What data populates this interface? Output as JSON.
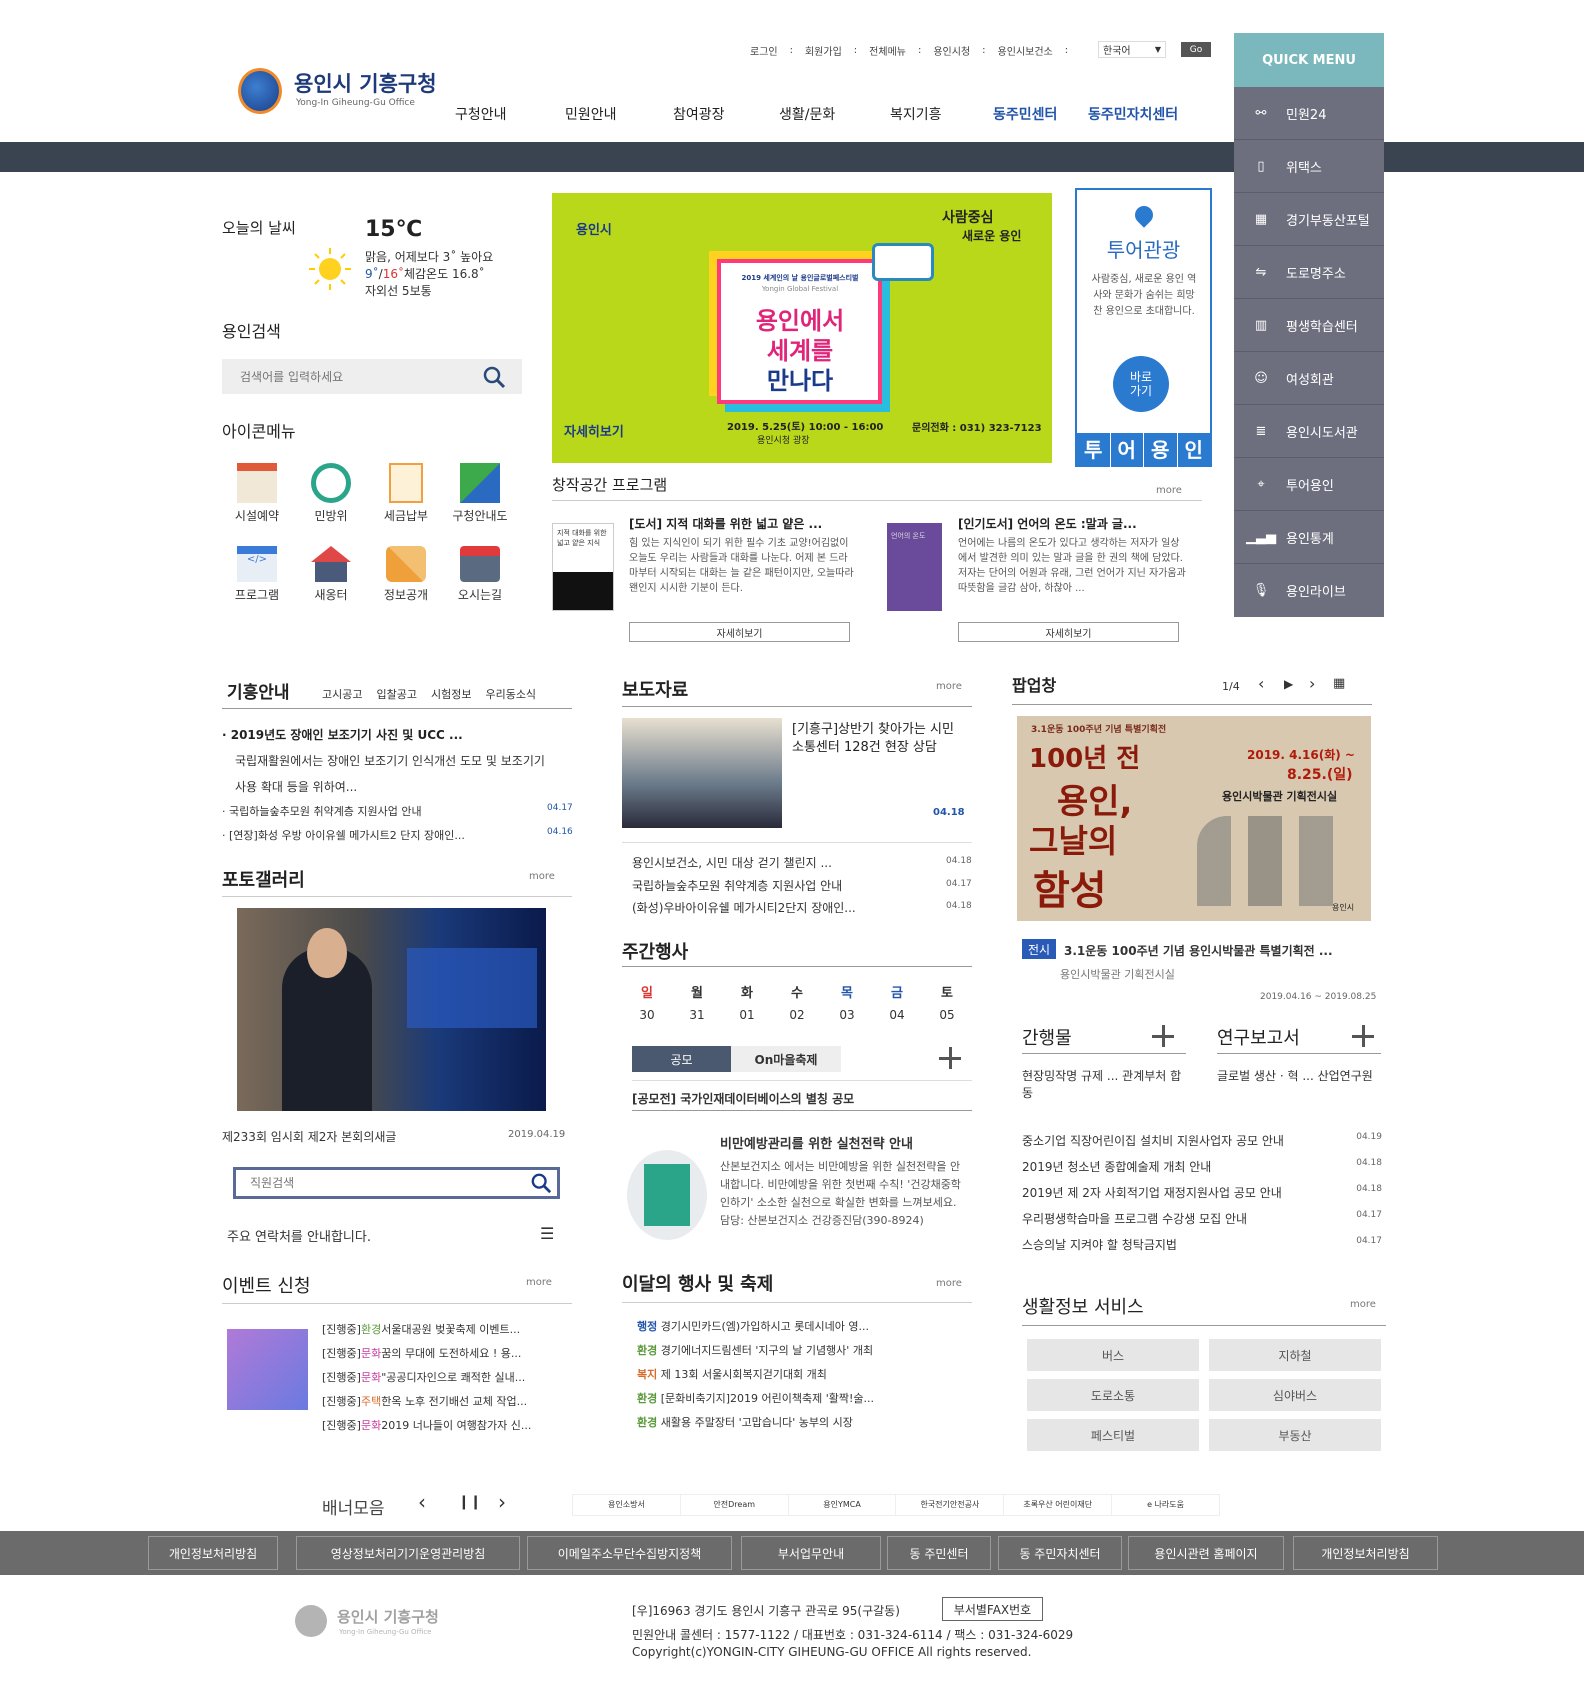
{
  "header": {
    "logo": {
      "name": "용인시 기흥구청",
      "sub": "Yong-In Giheung-Gu Office"
    },
    "util": [
      "로그인",
      "회원가입",
      "전체메뉴",
      "용인시청",
      "용인시보건소"
    ],
    "lang": "한국어",
    "go": "Go",
    "gnb": [
      "구청안내",
      "민원안내",
      "참여광장",
      "생활/문화",
      "복지기흥",
      "동주민센터",
      "동주민자치센터"
    ]
  },
  "quick_menu": {
    "title": "QUICK MENU",
    "items": [
      "민원24",
      "위택스",
      "경기부동산포털",
      "도로명주소",
      "평생학습센터",
      "여성회관",
      "용인시도서관",
      "투어용인",
      "용인통계",
      "용인라이브"
    ]
  },
  "weather": {
    "title": "오늘의 날씨",
    "temp": "15℃",
    "desc": "맑음, 어제보다 3˚ 높아요",
    "minmax_low": "9˚",
    "minmax_sep": "/",
    "minmax_high": "16˚",
    "feel": "체감온도 16.8˚",
    "uv": "자외선 5보통"
  },
  "search": {
    "title": "용인검색",
    "placeholder": "검색어를 입력하세요"
  },
  "icon_menu": {
    "title": "아이콘메뉴",
    "items": [
      "시설예약",
      "민방위",
      "세금납부",
      "구청안내도",
      "프로그램",
      "새옹터",
      "정보공개",
      "오시는길"
    ]
  },
  "banner": {
    "logo": "용인시",
    "slogan1": "사람중심",
    "slogan2": "새로운 용인",
    "festival_sub": "2019 세계인의 날 용인글로벌페스티벌",
    "festival_en": "Yongin Global Festival",
    "main1": "용인에서",
    "main2": "세계를",
    "main3": "만나다",
    "date": "2019. 5.25(토) 10:00 - 16:00",
    "place": "용인시청 광장",
    "contact": "문의전화 : 031) 323-7123",
    "detail": "자세히보기"
  },
  "tour": {
    "title": "투어관광",
    "desc": "사람중심, 새로운 용인 역사와 문화가 숨쉬는 희망찬 용인으로 초대합니다.",
    "go": "바로\n가기",
    "chars": [
      "투",
      "어",
      "용",
      "인"
    ]
  },
  "creative": {
    "title": "창작공간 프로그램",
    "more": "more",
    "books": [
      {
        "title": "[도서] 지적 대화를 위한 넓고 얕은 ...",
        "desc": "힘 있는 지식인이 되기 위한 필수 기초 교양!어김없이 오늘도 우리는 사람들과 대화를 나눈다. 어제 본 드라마부터 시작되는 대화는 늘 같은 패턴이지만, 오늘따라 왠인지 시시한 기분이 든다.",
        "btn": "자세히보기",
        "cover": "지적 대화를 위한 넓고 얕은 지식"
      },
      {
        "title": "[인기도서] 언어의 온도 :말과 글...",
        "desc": "언어에는 나름의 온도가 있다고 생각하는 저자가 일상에서 발견한 의미 있는 말과 글을 한 권의 책에 담았다. 저자는 단어의 어원과 유래, 그런 언어가 지닌 자가움과 따뜻함을 글감 삼아, 하찮아 ...",
        "btn": "자세히보기",
        "cover": "언어의 온도"
      }
    ]
  },
  "giheung": {
    "title": "기흥안내",
    "tabs": [
      "고시공고",
      "입찰공고",
      "시험정보",
      "우리동소식"
    ],
    "featured_title": "· 2019년도 장애인 보조기기 사진 및 UCC ...",
    "featured_desc": "국립재활원에서는 장애인 보조기기 인식개선 도모 및 보조기기 사용 확대 등을 위하여...",
    "items": [
      {
        "t": "· 국립하늘숲추모원 취약계층 지원사업 안내",
        "d": "04.17"
      },
      {
        "t": "· [연장]화성 우방 아이유쉘 메가시트2 단지 장애인...",
        "d": "04.16"
      }
    ]
  },
  "press": {
    "title": "보도자료",
    "more": "more",
    "featured": "[기흥구]상반기 찾아가는 시민소통센터 128건 현장 상담",
    "featured_date": "04.18",
    "items": [
      {
        "t": "용인시보건소, 시민 대상 걷기 챌린지 ...",
        "d": "04.18"
      },
      {
        "t": "국립하늘숲추모원 취약계층 지원사업 안내",
        "d": "04.17"
      },
      {
        "t": "(화성)우바아이유쉘 메가시티2단지 장애인...",
        "d": "04.18"
      }
    ]
  },
  "popup": {
    "title": "팝업창",
    "page": "1/4",
    "img_l1": "3.1운동 100주년 기념 특별기획전",
    "img_big1": "100년 전",
    "img_big2": "용인,",
    "img_big3": "그날의",
    "img_big4": "함성",
    "img_date1": "2019. 4.16(화) ~",
    "img_date2": "8.25.(일)",
    "img_place": "용인시박물관 기획전시실",
    "img_logo": "용인시",
    "badge": "전시",
    "caption": "3.1운동 100주년 기념 용인시박물관 특별기획전 ...",
    "sub": "용인시박물관 기획전시실",
    "period": "2019.04.16 ~ 2019.08.25"
  },
  "photo": {
    "title": "포토갤러리",
    "more": "more",
    "caption": "제233회 임시회 제2자 본회의새글",
    "date": "2019.04.19"
  },
  "weekly": {
    "title": "주간행사",
    "days": [
      "일",
      "월",
      "화",
      "수",
      "목",
      "금",
      "토"
    ],
    "dates": [
      "30",
      "31",
      "01",
      "02",
      "03",
      "04",
      "05"
    ],
    "tabs": [
      "공모",
      "On마을축제"
    ],
    "notice": "[공모전] 국가인재데이터베이스의 별칭 공모"
  },
  "health": {
    "title": "비만예방관리를 위한 실천전략 안내",
    "desc": "산본보건지소 에서는 비만예방을 위한 실천전략을 안내합니다. 비만예방을 위한 첫번째 수칙! '건강채중학인하기' 소소한 실천으로 확실한 변화를 느껴보세요. 담당: 산본보건지소 건강증진담(390-8924)"
  },
  "pubs": {
    "t1": "간행물",
    "t2": "연구보고서",
    "d1": "현장밍작명 규제 ... 관계부처 합동",
    "d2": "글로벌 생산 · 혁 ... 산업연구원"
  },
  "notices": [
    {
      "t": "중소기업 직장어린이집 설치비 지원사업자 공모 안내",
      "d": "04.19"
    },
    {
      "t": "2019년 청소년 종합예술제 개최 안내",
      "d": "04.18"
    },
    {
      "t": "2019년 제 2자 사회적기업 재정지원사업 공모 안내",
      "d": "04.18"
    },
    {
      "t": "우리평생학습마을 프로그램 수강생 모집 안내",
      "d": "04.17"
    },
    {
      "t": "스승의날 지켜야 할 청탁금지법",
      "d": "04.17"
    }
  ],
  "staff": {
    "placeholder": "직원검색",
    "contact": "주요 연락처를 안내합니다."
  },
  "event": {
    "title": "이벤트 신청",
    "more": "more",
    "items": [
      {
        "s": "[진행중]",
        "c": "환경",
        "t": "서울대공원 벚꽃축제 이벤트..."
      },
      {
        "s": "[진행중]",
        "c": "문화",
        "t": "꿈의 무대에 도전하세요 ! 용..."
      },
      {
        "s": "[진행중]",
        "c": "문화",
        "t": "\"공공디자인으로 쾌적한 실내..."
      },
      {
        "s": "[진행중]",
        "c": "주택",
        "t": "한옥 노후 전기배선 교체 작업..."
      },
      {
        "s": "[진행중]",
        "c": "문화",
        "t": "2019 너나들이 여행참가자 신..."
      }
    ]
  },
  "monthly": {
    "title": "이달의 행사 및 축제",
    "more": "more",
    "items": [
      {
        "c": "행정",
        "t": "경기시민카드(엠)가입하시고 롯데시네아 영..."
      },
      {
        "c": "환경",
        "t": "경기에너지드림센터 '지구의 날 기념행사' 개최"
      },
      {
        "c": "복지",
        "t": "제 13회 서울시회복지걷기대회 개최"
      },
      {
        "c": "환경",
        "t": "[문화비축기지]2019 어린이책축제 '활짝!술..."
      },
      {
        "c": "환경",
        "t": "새활용 주말장터 '고맙습니다' 농부의 시장"
      }
    ]
  },
  "life": {
    "title": "생활정보 서비스",
    "more": "more",
    "items": [
      "버스",
      "지하철",
      "도로소통",
      "심야버스",
      "페스티벌",
      "부동산"
    ]
  },
  "banners": {
    "title": "배너모음",
    "items": [
      "용인소방서",
      "안전Dream",
      "용인YMCA",
      "한국전기안전공사",
      "초록우산 어린이재단",
      "e 나라도움"
    ]
  },
  "footer": {
    "nav": [
      "개인정보처리방침",
      "영상정보처리기기운영관리방침",
      "이메일주소무단수집방지정책",
      "부서업무안내",
      "동 주민센터",
      "동 주민자치센터",
      "용인시관련 홈페이지",
      "개인정보처리방침"
    ],
    "address": "[우]16963 경기도 용인시 기흥구 관곡로 95(구갈동)",
    "fax": "부서별FAX번호",
    "phone": "민원안내 콜센터 : 1577-1122 / 대표번호 : 031-324-6114 / 팩스 : 031-324-6029",
    "copy": "Copyright(c)YONGIN-CITY GIHEUNG-GU OFFICE All rights reserved.",
    "logo": "용인시 기흥구청",
    "logo_sub": "Yong-In Giheung-Gu Office"
  },
  "colors": {
    "dark": "#3a4350",
    "teal": "#7ab8bd",
    "qm": "#6e6f7e",
    "blue": "#2255aa",
    "red": "#d33",
    "green": "#5a9a3a"
  }
}
